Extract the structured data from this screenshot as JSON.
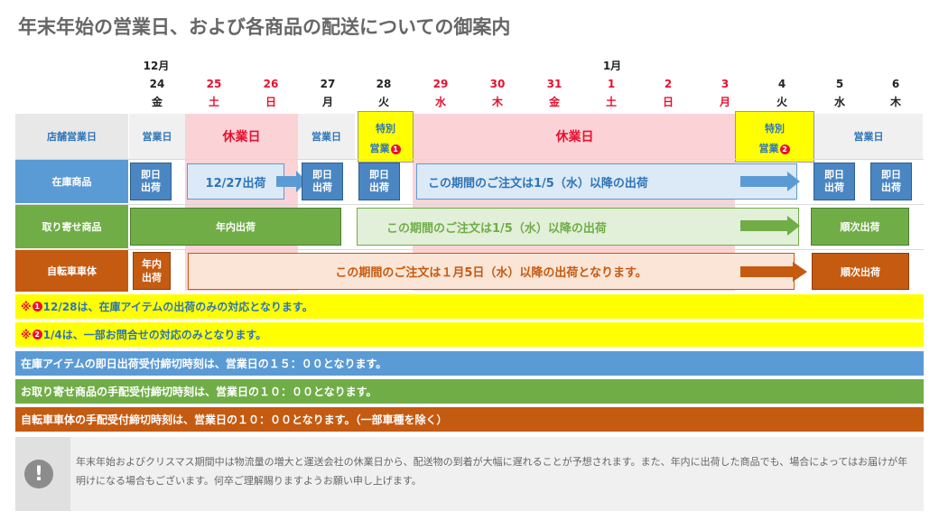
{
  "title": "年末年始の営業日、および各商品の配送についての御案内",
  "months": {
    "dec": "12月",
    "jan": "1月"
  },
  "dates": [
    {
      "day": "24",
      "dow": "金"
    },
    {
      "day": "25",
      "dow": "土"
    },
    {
      "day": "26",
      "dow": "日"
    },
    {
      "day": "27",
      "dow": "月"
    },
    {
      "day": "28",
      "dow": "火"
    },
    {
      "day": "29",
      "dow": "水"
    },
    {
      "day": "30",
      "dow": "木"
    },
    {
      "day": "31",
      "dow": "金"
    },
    {
      "day": "1",
      "dow": "土"
    },
    {
      "day": "2",
      "dow": "日"
    },
    {
      "day": "3",
      "dow": "月"
    },
    {
      "day": "4",
      "dow": "火"
    },
    {
      "day": "5",
      "dow": "水"
    },
    {
      "day": "6",
      "dow": "木"
    }
  ],
  "rows": {
    "store": "店舗営業日",
    "stock": "在庫商品",
    "order": "取り寄せ商品",
    "bike": "自転車車体"
  },
  "store": {
    "open1": "営業日",
    "closed1": "休業日",
    "open2": "営業日",
    "special1_top": "特別",
    "special1_bottom": "営業",
    "special1_num": "❶",
    "closed2": "休業日",
    "special2_top": "特別",
    "special2_bottom": "営業",
    "special2_num": "❷",
    "open3": "営業日"
  },
  "stock": {
    "same_day_1": "即日\n出荷",
    "ship_1227": "12/27出荷",
    "same_day_2": "即日\n出荷",
    "same_day_3": "即日\n出荷",
    "period_msg": "この期間のご注文は1/5（水）以降の出荷",
    "same_day_4": "即日\n出荷",
    "same_day_5": "即日\n出荷"
  },
  "order": {
    "within_year": "年内出荷",
    "period_msg": "この期間のご注文は1/5（水）以降の出荷",
    "sequential": "順次出荷"
  },
  "bike": {
    "within_year": "年内\n出荷",
    "period_msg": "この期間のご注文は１月5日（水）以降の出荷となります。",
    "sequential": "順次出荷"
  },
  "notes": {
    "n1_prefix": "※",
    "n1_num": "❶",
    "n1_text": "12/28は、在庫アイテムの出荷のみの対応となります。",
    "n2_prefix": "※",
    "n2_num": "❷",
    "n2_text": "1/4は、一部お問合せの対応のみとなります。",
    "n3": "在庫アイテムの即日出荷受付締切時刻は、営業日の１５：００となります。",
    "n4": "お取り寄せ商品の手配受付締切時刻は、営業日の１０：００となります。",
    "n5": "自転車車体の手配受付締切時刻は、営業日の１０：００となります。（一部車種を除く）"
  },
  "info": {
    "icon": "exclamation-icon",
    "text": "年末年始およびクリスマス期間中は物流量の増大と運送会社の休業日から、配送物の到着が大幅に遅れることが予想されます。また、年内に出荷した商品でも、場合によってはお届けが年明けになる場合もございます。何卒ご理解賜りますようお願い申し上げます。"
  },
  "colors": {
    "blue": "#5b9bd5",
    "green": "#70ad47",
    "orange": "#c55a11",
    "yellow": "#ffff00",
    "pink": "#fbd3d6",
    "red": "#e8102f",
    "gray": "#f0f0f0"
  }
}
